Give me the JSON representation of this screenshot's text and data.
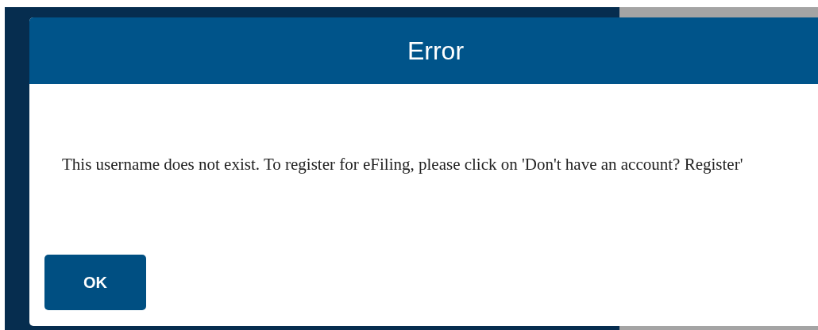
{
  "dialog": {
    "title": "Error",
    "message": "This username does not exist. To register for eFiling, please click on 'Don't have an account? Register'",
    "buttons": [
      "OK"
    ]
  }
}
